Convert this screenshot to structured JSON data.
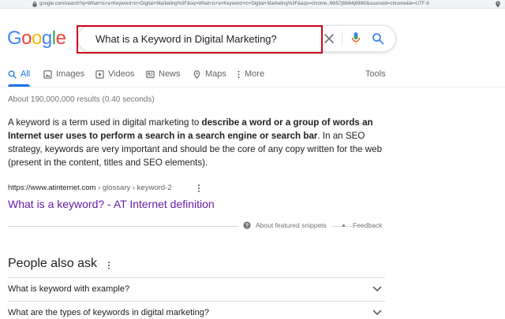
{
  "browser": {
    "url": "google.com/search?q=What+is+a+Keyword+in+Digital+Marketing%3F&oq=What+is+a+Keyword+in+Digital+Marketing%3F&aqs=chrome..69i57j69i64j69i60&sourceid=chrome&ie=UTF-8"
  },
  "logo": {
    "letters": [
      "G",
      "o",
      "o",
      "g",
      "l",
      "e"
    ],
    "colors": [
      "#4285f4",
      "#ea4335",
      "#fbbc05",
      "#4285f4",
      "#34a853",
      "#ea4335"
    ]
  },
  "search": {
    "query": "What is a Keyword in Digital Marketing?",
    "highlight_color": "#d0021b"
  },
  "tabs": [
    {
      "label": "All",
      "icon": "search-icon",
      "active": true
    },
    {
      "label": "Images",
      "icon": "image-icon",
      "active": false
    },
    {
      "label": "Videos",
      "icon": "play-icon",
      "active": false
    },
    {
      "label": "News",
      "icon": "newspaper-icon",
      "active": false
    },
    {
      "label": "Maps",
      "icon": "map-pin-icon",
      "active": false
    },
    {
      "label": "More",
      "icon": "kebab-menu-icon",
      "active": false
    }
  ],
  "tools_label": "Tools",
  "result_stats": "About 190,000,000 results (0.40 seconds)",
  "featured_snippet": {
    "part1": "A keyword is a term used in digital marketing to ",
    "bold": "describe a word or a group of words an Internet user uses to perform a search in a search engine or search bar",
    "part2": ". In an SEO strategy, keywords are very important and should be the core of any copy written for the web (present in the content, titles and SEO elements).",
    "cite_domain": "https://www.atinternet.com",
    "cite_path": " › glossary › keyword-2",
    "title": "What is a keyword? - AT Internet definition",
    "about_label": "About featured snippets",
    "feedback_label": "Feedback"
  },
  "people_also_ask": {
    "title": "People also ask",
    "questions": [
      "What is keyword with example?",
      "What are the types of keywords in digital marketing?"
    ]
  },
  "colors": {
    "link_visited": "#681da8",
    "accent": "#1a73e8",
    "muted": "#70757a"
  }
}
